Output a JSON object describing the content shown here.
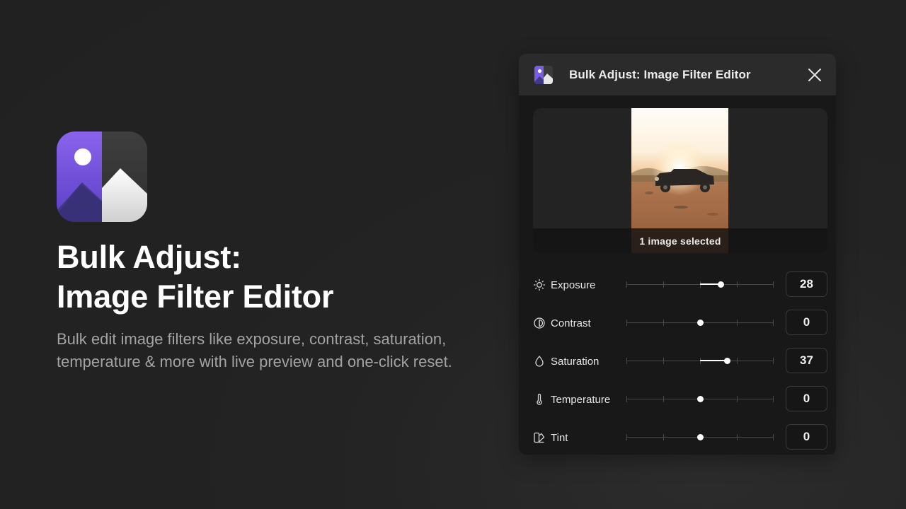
{
  "hero": {
    "title_line1": "Bulk Adjust:",
    "title_line2": "Image Filter Editor",
    "description": "Bulk edit image filters like exposure, contrast, saturation, temperature & more with live preview and one-click reset."
  },
  "panel": {
    "title": "Bulk Adjust: Image Filter Editor",
    "close_icon": "close-icon",
    "preview_caption": "1 image selected"
  },
  "colors": {
    "brand_purple": "#7b5ce6",
    "background": "#212121",
    "panel_header": "#2b2b2b"
  },
  "adjustments": [
    {
      "icon": "sun-icon",
      "label": "Exposure",
      "value": "28",
      "level": 28
    },
    {
      "icon": "contrast-icon",
      "label": "Contrast",
      "value": "0",
      "level": 0
    },
    {
      "icon": "droplet-icon",
      "label": "Saturation",
      "value": "37",
      "level": 37
    },
    {
      "icon": "thermometer-icon",
      "label": "Temperature",
      "value": "0",
      "level": 0
    },
    {
      "icon": "tint-icon",
      "label": "Tint",
      "value": "0",
      "level": 0
    }
  ],
  "slider_range": [
    -100,
    100
  ]
}
